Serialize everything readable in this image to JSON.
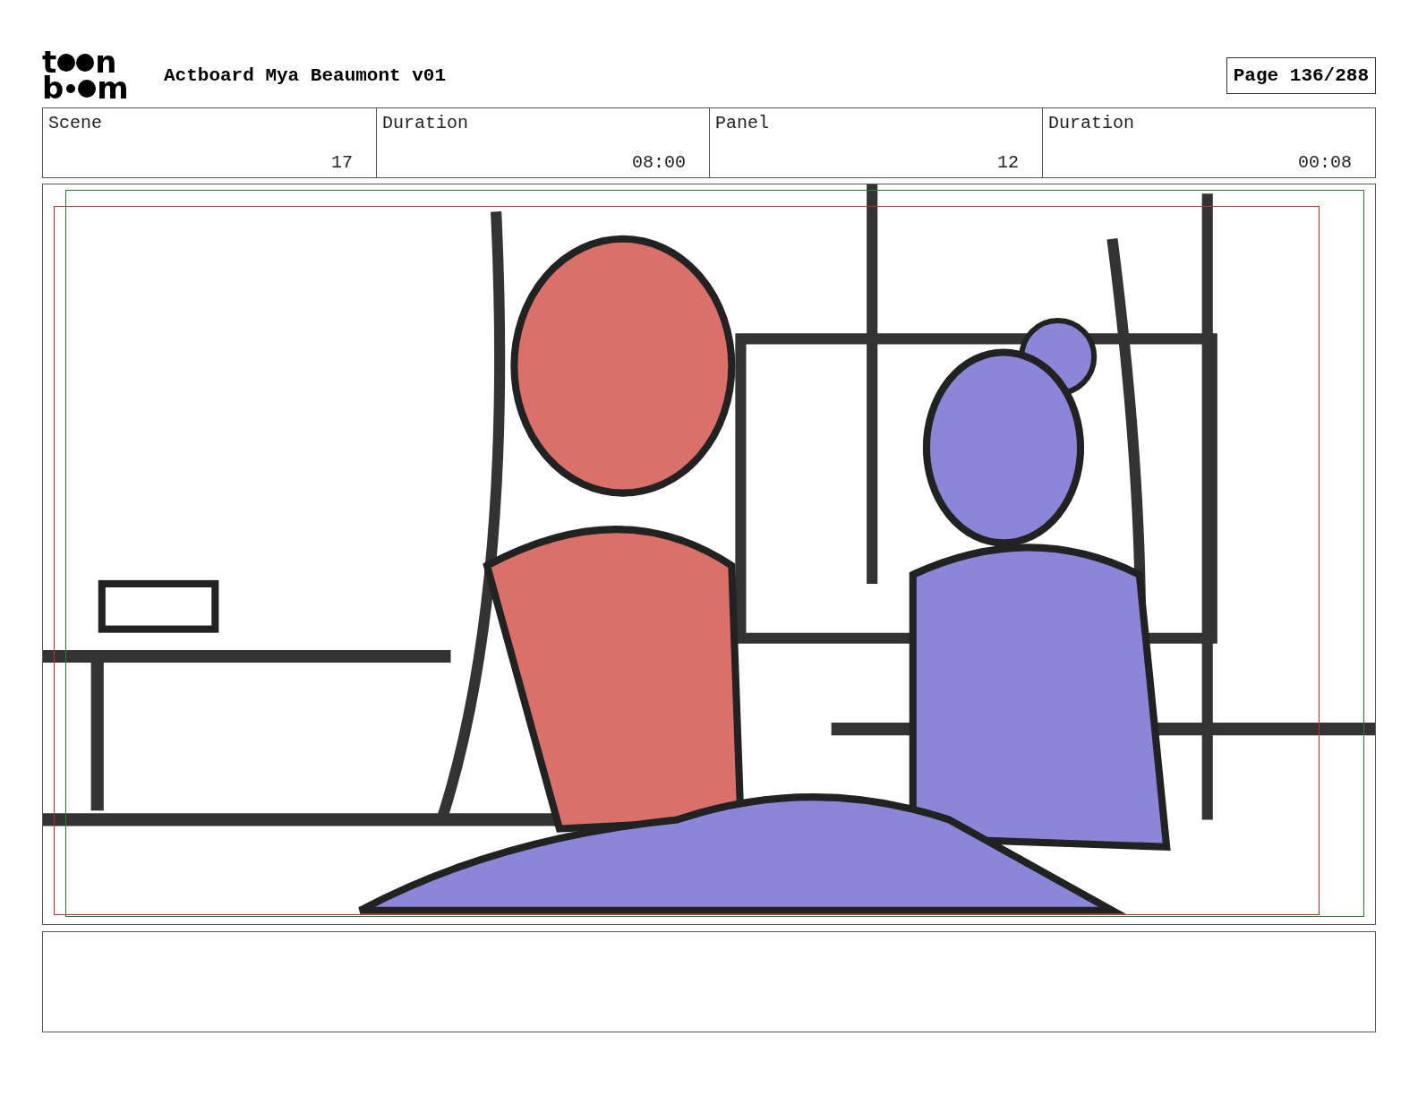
{
  "logo": {
    "lines": [
      {
        "start": "t",
        "end": "n"
      },
      {
        "start": "b",
        "end": "m"
      }
    ]
  },
  "title": "Actboard Mya Beaumont v01",
  "page": "Page 136/288",
  "fields": [
    {
      "label": "Scene",
      "value": "17"
    },
    {
      "label": "Duration",
      "value": "08:00"
    },
    {
      "label": "Panel",
      "value": "12"
    },
    {
      "label": "Duration",
      "value": "00:08"
    }
  ]
}
